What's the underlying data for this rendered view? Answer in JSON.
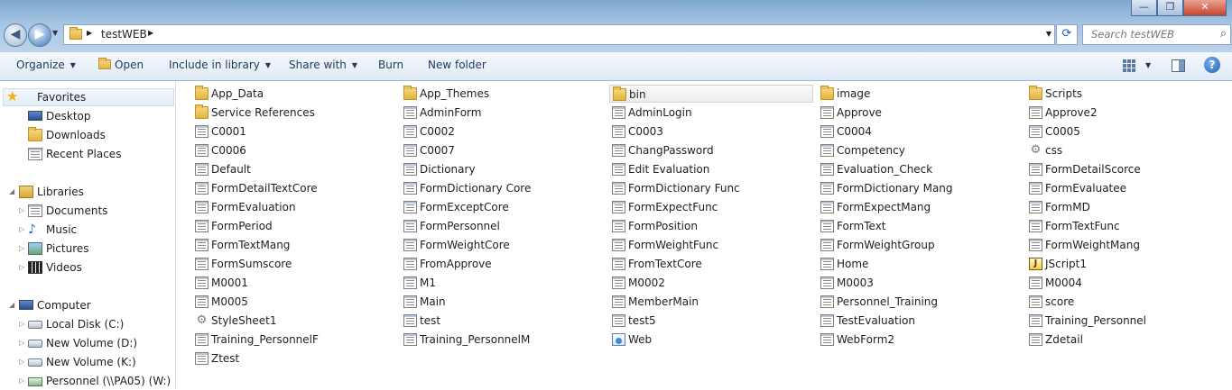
{
  "window": {
    "controls": {
      "minimize": "—",
      "maximize": "❐",
      "close": "✕"
    }
  },
  "address_bar": {
    "path": "testWEB",
    "search_placeholder": "Search testWEB"
  },
  "toolbar": {
    "organize": "Organize",
    "open": "Open",
    "include_in_library": "Include in library",
    "share_with": "Share with",
    "burn": "Burn",
    "new_folder": "New folder",
    "help": "?"
  },
  "nav": {
    "favorites": "Favorites",
    "desktop": "Desktop",
    "downloads": "Downloads",
    "recent_places": "Recent Places",
    "libraries": "Libraries",
    "documents": "Documents",
    "music": "Music",
    "pictures": "Pictures",
    "videos": "Videos",
    "computer": "Computer",
    "local_disk": "Local Disk (C:)",
    "new_volume_d": "New Volume (D:)",
    "new_volume_k": "New Volume (K:)",
    "personnel": "Personnel (\\\\PA05) (W:)"
  },
  "files": [
    {
      "name": "App_Data",
      "icon": "folder-icon"
    },
    {
      "name": "App_Themes",
      "icon": "folder-icon"
    },
    {
      "name": "bin",
      "icon": "folder-icon"
    },
    {
      "name": "image",
      "icon": "folder-icon"
    },
    {
      "name": "Scripts",
      "icon": "folder-icon"
    },
    {
      "name": "Service References",
      "icon": "folder-icon"
    },
    {
      "name": "AdminForm",
      "icon": "document-icon"
    },
    {
      "name": "AdminLogin",
      "icon": "document-icon"
    },
    {
      "name": "Approve",
      "icon": "document-icon"
    },
    {
      "name": "Approve2",
      "icon": "document-icon"
    },
    {
      "name": "C0001",
      "icon": "document-icon"
    },
    {
      "name": "C0002",
      "icon": "document-icon"
    },
    {
      "name": "C0003",
      "icon": "document-icon"
    },
    {
      "name": "C0004",
      "icon": "document-icon"
    },
    {
      "name": "C0005",
      "icon": "document-icon"
    },
    {
      "name": "C0006",
      "icon": "document-icon"
    },
    {
      "name": "C0007",
      "icon": "document-icon"
    },
    {
      "name": "ChangPassword",
      "icon": "document-icon"
    },
    {
      "name": "Competency",
      "icon": "document-icon"
    },
    {
      "name": "css",
      "icon": "gear-icon"
    },
    {
      "name": "Default",
      "icon": "document-icon"
    },
    {
      "name": "Dictionary",
      "icon": "document-icon"
    },
    {
      "name": "Edit Evaluation",
      "icon": "document-icon"
    },
    {
      "name": "Evaluation_Check",
      "icon": "document-icon"
    },
    {
      "name": "FormDetailScorce",
      "icon": "document-icon"
    },
    {
      "name": "FormDetailTextCore",
      "icon": "document-icon"
    },
    {
      "name": "FormDictionary Core",
      "icon": "document-icon"
    },
    {
      "name": "FormDictionary Func",
      "icon": "document-icon"
    },
    {
      "name": "FormDictionary Mang",
      "icon": "document-icon"
    },
    {
      "name": "FormEvaluatee",
      "icon": "document-icon"
    },
    {
      "name": "FormEvaluation",
      "icon": "document-icon"
    },
    {
      "name": "FormExceptCore",
      "icon": "document-icon"
    },
    {
      "name": "FormExpectFunc",
      "icon": "document-icon"
    },
    {
      "name": "FormExpectMang",
      "icon": "document-icon"
    },
    {
      "name": "FormMD",
      "icon": "document-icon"
    },
    {
      "name": "FormPeriod",
      "icon": "document-icon"
    },
    {
      "name": "FormPersonnel",
      "icon": "document-icon"
    },
    {
      "name": "FormPosition",
      "icon": "document-icon"
    },
    {
      "name": "FormText",
      "icon": "document-icon"
    },
    {
      "name": "FormTextFunc",
      "icon": "document-icon"
    },
    {
      "name": "FormTextMang",
      "icon": "document-icon"
    },
    {
      "name": "FormWeightCore",
      "icon": "document-icon"
    },
    {
      "name": "FormWeightFunc",
      "icon": "document-icon"
    },
    {
      "name": "FormWeightGroup",
      "icon": "document-icon"
    },
    {
      "name": "FormWeightMang",
      "icon": "document-icon"
    },
    {
      "name": "FormSumscore",
      "icon": "document-icon"
    },
    {
      "name": "FromApprove",
      "icon": "document-icon"
    },
    {
      "name": "FromTextCore",
      "icon": "document-icon"
    },
    {
      "name": "Home",
      "icon": "document-icon"
    },
    {
      "name": "JScript1",
      "icon": "script-icon"
    },
    {
      "name": "M0001",
      "icon": "document-icon"
    },
    {
      "name": "M1",
      "icon": "document-icon"
    },
    {
      "name": "M0002",
      "icon": "document-icon"
    },
    {
      "name": "M0003",
      "icon": "document-icon"
    },
    {
      "name": "M0004",
      "icon": "document-icon"
    },
    {
      "name": "M0005",
      "icon": "document-icon"
    },
    {
      "name": "Main",
      "icon": "document-icon"
    },
    {
      "name": "MemberMain",
      "icon": "document-icon"
    },
    {
      "name": "Personnel_Training",
      "icon": "document-icon"
    },
    {
      "name": "score",
      "icon": "document-icon"
    },
    {
      "name": "StyleSheet1",
      "icon": "gear-icon"
    },
    {
      "name": "test",
      "icon": "document-icon"
    },
    {
      "name": "test5",
      "icon": "document-icon"
    },
    {
      "name": "TestEvaluation",
      "icon": "document-icon"
    },
    {
      "name": "Training_Personnel",
      "icon": "document-icon"
    },
    {
      "name": "Training_PersonnelF",
      "icon": "document-icon"
    },
    {
      "name": "Training_PersonnelM",
      "icon": "document-icon"
    },
    {
      "name": "Web",
      "icon": "web-config-icon"
    },
    {
      "name": "WebForm2",
      "icon": "document-icon"
    },
    {
      "name": "Zdetail",
      "icon": "document-icon"
    },
    {
      "name": "Ztest",
      "icon": "document-icon"
    }
  ],
  "selected_file": "bin"
}
